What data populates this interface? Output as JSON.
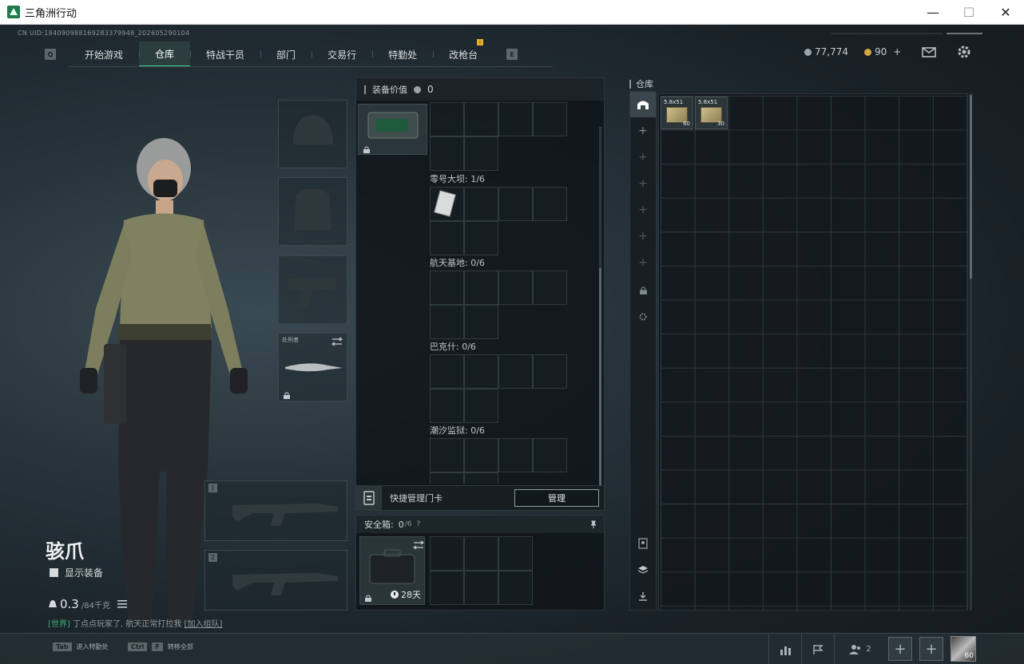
{
  "window": {
    "title": "三角洲行动",
    "minimize": "—",
    "maximize": "☐",
    "close": "✕"
  },
  "uid": "CN UID:1840909881692833799​48_202605290104",
  "nav": {
    "left_key": "Q",
    "right_key": "E",
    "tabs": [
      {
        "label": "开始游戏"
      },
      {
        "label": "仓库"
      },
      {
        "label": "特战干员"
      },
      {
        "label": "部门"
      },
      {
        "label": "交易行"
      },
      {
        "label": "特勤处"
      },
      {
        "label": "改枪台"
      }
    ],
    "active_index": 1,
    "badge": "!"
  },
  "currency": {
    "silver": "77,774",
    "gold": "90",
    "gold_add": "+"
  },
  "character": {
    "name": "骇爪",
    "show_equipment": "显示装备",
    "weight": "0.3",
    "weight_max": "/84千克"
  },
  "chat": {
    "channel": "[世界]",
    "message": "丁点点玩家了, 航天正常打拉我",
    "link": "[加入组队]"
  },
  "equip_slots": {
    "melee_label": "处刑者",
    "primary_num": "1",
    "secondary_num": "2"
  },
  "middle": {
    "header_label": "装备价值",
    "header_value": "0",
    "maps": [
      {
        "label": "零号大坝: 1/6"
      },
      {
        "label": "航天基地: 0/6"
      },
      {
        "label": "巴克什: 0/6"
      },
      {
        "label": "潮汐监狱: 0/6"
      }
    ],
    "keycard_label": "快捷管理门卡",
    "manage_button": "管理",
    "safe_label": "安全箱:",
    "safe_value": "0",
    "safe_max": "/6",
    "safe_days": "28天"
  },
  "warehouse": {
    "label": "仓库",
    "items": [
      {
        "name": "5.8x51",
        "qty": "60"
      },
      {
        "name": "5.8x51",
        "qty": "30"
      }
    ]
  },
  "bottom": {
    "tab_key": "Tab",
    "tab_hint": "进入特勤处",
    "ctrl_key": "Ctrl",
    "f_key": "F",
    "ctrl_hint": "转移全部",
    "team_count": "2",
    "add": "+",
    "level": "60"
  },
  "colors": {
    "accent": "#3ecf8e",
    "badge": "#e3b12b",
    "world_channel": "#3fae72"
  }
}
